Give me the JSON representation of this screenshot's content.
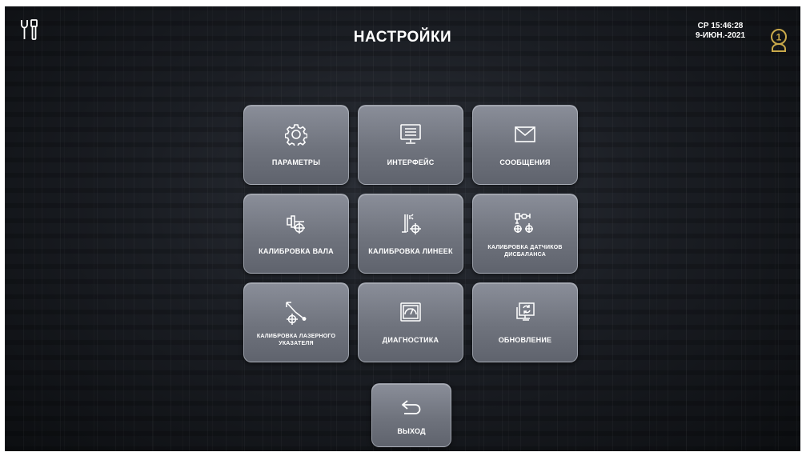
{
  "header": {
    "title": "НАСТРОЙКИ",
    "clock_time": "СР 15:46:28",
    "clock_date": "9-ИЮН.-2021",
    "user_badge": "1"
  },
  "icons": {
    "tools": "wrench-screwdriver-icon",
    "user": "user-icon"
  },
  "tiles": [
    {
      "label": "ПАРАМЕТРЫ",
      "icon": "gear-icon"
    },
    {
      "label": "ИНТЕРФЕЙС",
      "icon": "monitor-icon"
    },
    {
      "label": "СООБЩЕНИЯ",
      "icon": "envelope-icon"
    },
    {
      "label": "КАЛИБРОВКА ВАЛА",
      "icon": "shaft-calibration-icon"
    },
    {
      "label": "КАЛИБРОВКА ЛИНЕЕК",
      "icon": "ruler-calibration-icon"
    },
    {
      "label": "КАЛИБРОВКА ДАТЧИКОВ ДИСБАЛАНСА",
      "icon": "sensor-calibration-icon"
    },
    {
      "label": "КАЛИБРОВКА ЛАЗЕРНОГО УКАЗАТЕЛЯ",
      "icon": "laser-calibration-icon"
    },
    {
      "label": "ДИАГНОСТИКА",
      "icon": "gauge-icon"
    },
    {
      "label": "ОБНОВЛЕНИЕ",
      "icon": "update-icon"
    }
  ],
  "exit": {
    "label": "ВЫХОД",
    "icon": "return-arrow-icon"
  },
  "colors": {
    "tile_top": "#8a8e99",
    "tile_bottom": "#5f636d",
    "user_icon": "#c9a94a",
    "text": "#ffffff"
  }
}
